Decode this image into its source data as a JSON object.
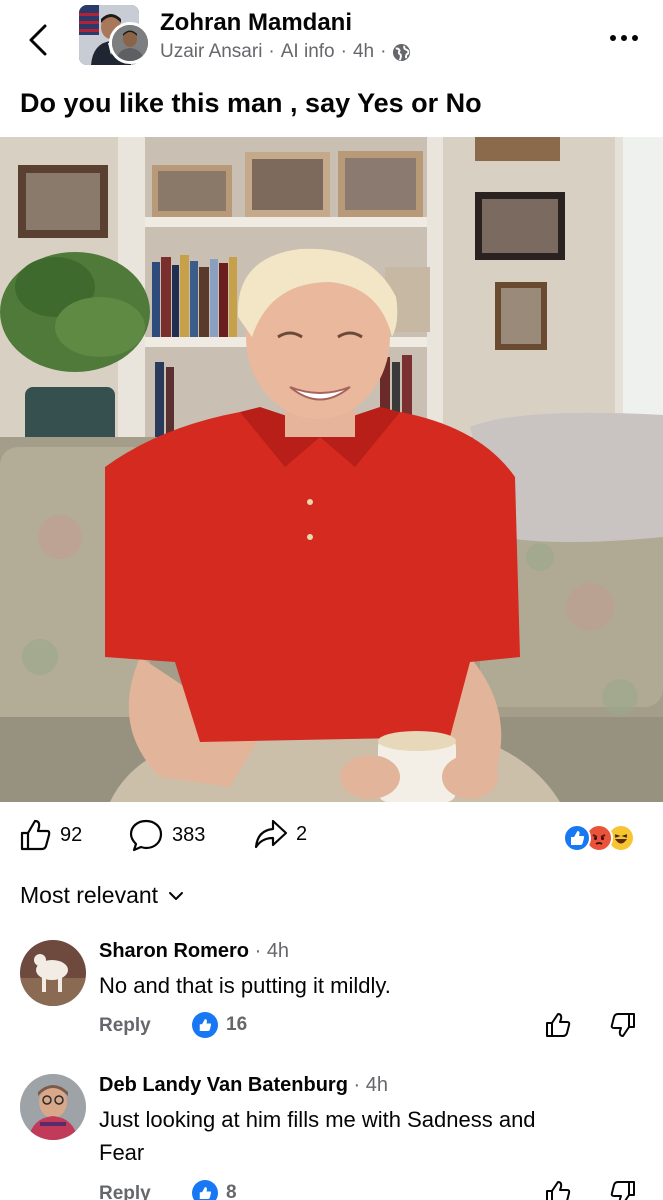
{
  "header": {
    "page_name": "Zohran Mamdani",
    "author": "Uzair Ansari",
    "ai_label": "AI info",
    "time": "4h",
    "separator": "·"
  },
  "post": {
    "text": "Do you like this man , say Yes or No",
    "photo_icon": "photo-of-smiling-man-on-sofa"
  },
  "actions": {
    "likes": "92",
    "comments": "383",
    "shares": "2",
    "reactions": [
      "like",
      "angry",
      "haha"
    ]
  },
  "sort_label": "Most relevant",
  "comments": [
    {
      "name": "Sharon Romero",
      "time": "4h",
      "text": "No and that is putting it mildly.",
      "reply": "Reply",
      "likes": "16"
    },
    {
      "name": "Deb Landy Van Batenburg",
      "time": "4h",
      "text": "Just looking at him fills me with Sadness and Fear",
      "reply": "Reply",
      "likes": "8"
    }
  ],
  "colors": {
    "text": "#050505",
    "secondary": "#65676b",
    "brand_blue": "#1877f2",
    "shirt_red": "#d42a20"
  }
}
